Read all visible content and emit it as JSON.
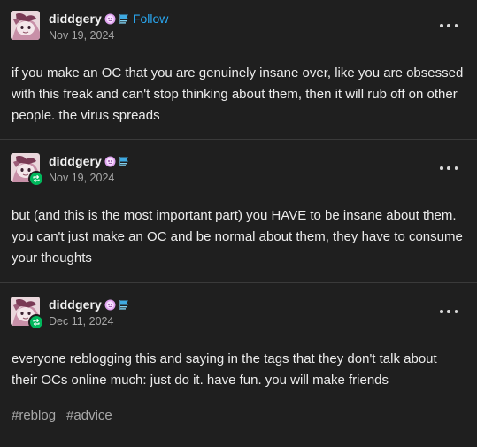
{
  "posts": [
    {
      "username": "diddgery",
      "follow_label": "Follow",
      "date": "Nov 19, 2024",
      "reblog": false,
      "body": "if you make an OC that you are genuinely insane over, like you are obsessed with this freak and can't stop thinking about them, then it will rub off on other people. the virus spreads"
    },
    {
      "username": "diddgery",
      "date": "Nov 19, 2024",
      "reblog": true,
      "body": "but (and this is the most important part) you HAVE to be insane about them. you can't just make an OC and be normal about them, they have to consume your thoughts"
    },
    {
      "username": "diddgery",
      "date": "Dec 11, 2024",
      "reblog": true,
      "body": "everyone reblogging this and saying in the tags that they don't talk about their OCs online much: just do it. have fun. you will make friends",
      "tags": [
        "#reblog",
        "#advice"
      ]
    }
  ],
  "icons": {
    "more": "more-dots-icon",
    "reblog": "reblog-arrows-icon",
    "badge1": "pink-face-badge-icon",
    "badge2": "blue-flag-badge-icon"
  },
  "colors": {
    "background": "#1f1f1f",
    "accent_link": "#2aa7f0",
    "reblog_green": "#00b85c",
    "muted_text": "#a8a8a8",
    "divider": "#3a3a3a"
  }
}
